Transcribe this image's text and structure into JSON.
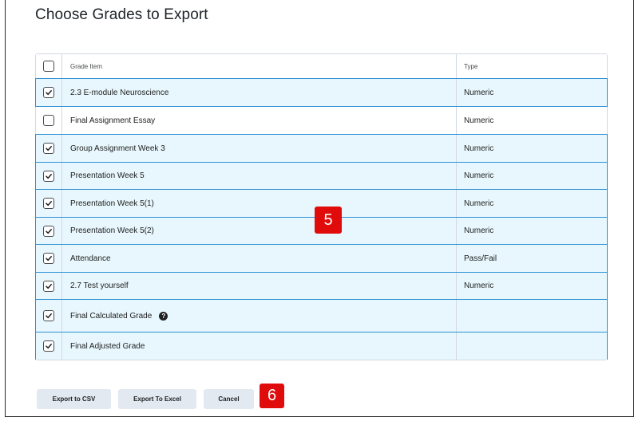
{
  "page": {
    "title": "Choose Grades to Export"
  },
  "table": {
    "headers": {
      "grade_item": "Grade Item",
      "type": "Type"
    },
    "header_checked": false,
    "rows": [
      {
        "name": "2.3 E-module Neuroscience",
        "type": "Numeric",
        "checked": true
      },
      {
        "name": "Final Assignment Essay",
        "type": "Numeric",
        "checked": false
      },
      {
        "name": "Group Assignment Week 3",
        "type": "Numeric",
        "checked": true
      },
      {
        "name": "Presentation Week 5",
        "type": "Numeric",
        "checked": true
      },
      {
        "name": "Presentation Week 5(1)",
        "type": "Numeric",
        "checked": true
      },
      {
        "name": "Presentation Week 5(2)",
        "type": "Numeric",
        "checked": true
      },
      {
        "name": "Attendance",
        "type": "Pass/Fail",
        "checked": true
      },
      {
        "name": "2.7 Test yourself",
        "type": "Numeric",
        "checked": true
      },
      {
        "name": "Final Calculated Grade",
        "type": "",
        "checked": true,
        "help_icon": "help-icon"
      },
      {
        "name": "Final Adjusted Grade",
        "type": "",
        "checked": true
      }
    ]
  },
  "buttons": {
    "export_csv": "Export to CSV",
    "export_excel": "Export To Excel",
    "cancel": "Cancel"
  },
  "annotations": {
    "table_step": "5",
    "buttons_step": "6"
  },
  "colors": {
    "selected_row_bg": "#e8f7fd",
    "selected_row_border": "#2d8fd3",
    "button_bg": "#e3e9f1",
    "badge_red": "#e00b0b"
  }
}
